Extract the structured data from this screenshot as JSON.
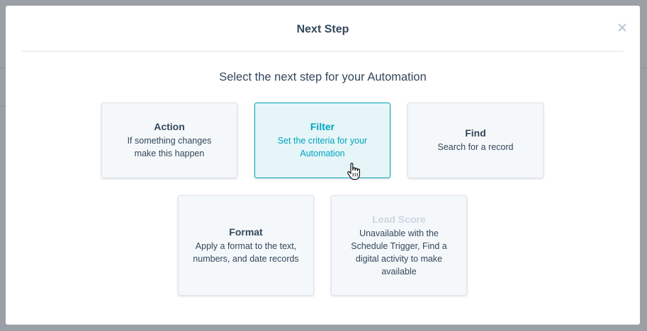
{
  "modal": {
    "title": "Next Step",
    "close_label": "×",
    "subtitle": "Select the next step for your Automation"
  },
  "cards": [
    {
      "id": "action",
      "title": "Action",
      "description": "If something changes make this happen",
      "state": "default"
    },
    {
      "id": "filter",
      "title": "Filter",
      "description": "Set the criteria for your Automation",
      "state": "hover"
    },
    {
      "id": "find",
      "title": "Find",
      "description": "Search for a record",
      "state": "default"
    },
    {
      "id": "format",
      "title": "Format",
      "description": "Apply a format to the text, numbers, and date records",
      "state": "default"
    },
    {
      "id": "lead-score",
      "title": "Lead Score",
      "description": "Unavailable with the Schedule Trigger, Find a digital activity to make available",
      "state": "disabled"
    }
  ],
  "colors": {
    "accent": "#00a4bd",
    "text": "#33475b",
    "disabled_text": "#cbd6e2",
    "card_bg": "#f5f8fa"
  }
}
